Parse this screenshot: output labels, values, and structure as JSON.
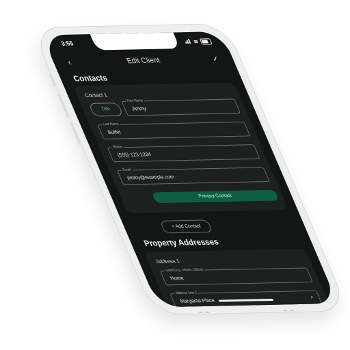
{
  "status": {
    "time": "3:55"
  },
  "header": {
    "back_icon": "chevron-left-icon",
    "title": "Edit Client",
    "check_icon": "check-icon"
  },
  "contacts": {
    "section_title": "Contacts",
    "card": {
      "title": "Contact 1",
      "title_button": "Title",
      "first_name": {
        "label": "First Name",
        "value": "Jimmy"
      },
      "last_name": {
        "label": "Last Name",
        "value": "Buffet"
      },
      "phone": {
        "label": "Phone",
        "value": "(555) 123-1234"
      },
      "email": {
        "label": "Email",
        "value": "jimmy@example.com"
      },
      "primary_button": "Primary Contact"
    },
    "add_contact": "+ Add Contact"
  },
  "property": {
    "section_title": "Property Addresses",
    "card": {
      "title": "Address 1",
      "label_field": {
        "label": "Label (e.g., Home, Office)",
        "value": "Home"
      },
      "address_line": {
        "label": "Address Line 1",
        "value": "Margarita Place"
      }
    }
  },
  "colors": {
    "screen_bg": "#131615",
    "card_bg": "#1c201f",
    "accent": "#0d5e45",
    "accent_text": "#6fbf9e"
  }
}
